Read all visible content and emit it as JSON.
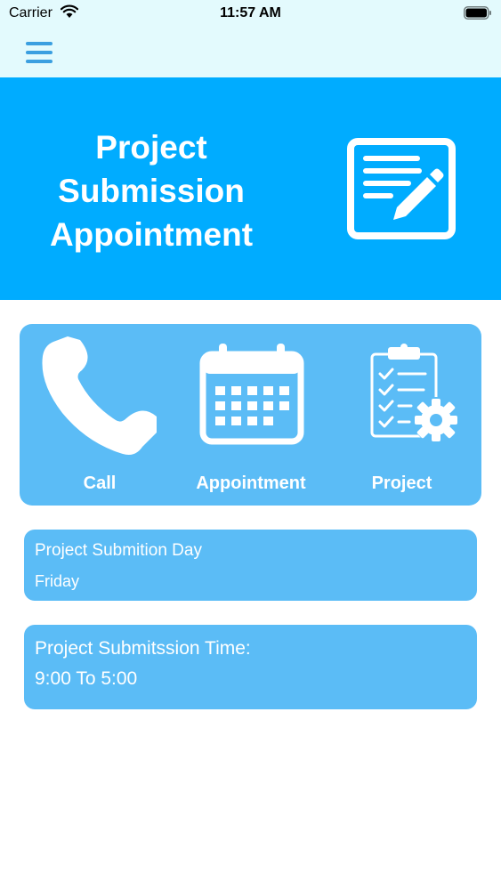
{
  "status_bar": {
    "carrier": "Carrier",
    "time": "11:57 AM"
  },
  "header": {
    "menu_icon": "hamburger-menu-icon"
  },
  "banner": {
    "title": "Project Submission Appointment",
    "icon": "edit-document-icon",
    "background": "#00acff"
  },
  "actions": [
    {
      "label": "Call",
      "icon": "phone-icon"
    },
    {
      "label": "Appointment",
      "icon": "calendar-icon"
    },
    {
      "label": "Project",
      "icon": "clipboard-settings-icon"
    }
  ],
  "submission_day": {
    "label": "Project Submition Day",
    "value": "Friday"
  },
  "submission_time": {
    "label": "Project Submitssion Time:",
    "value": "9:00 To 5:00"
  },
  "colors": {
    "navbar": "#e3fafd",
    "panel": "#5bbcf6",
    "accent": "#00acff"
  }
}
